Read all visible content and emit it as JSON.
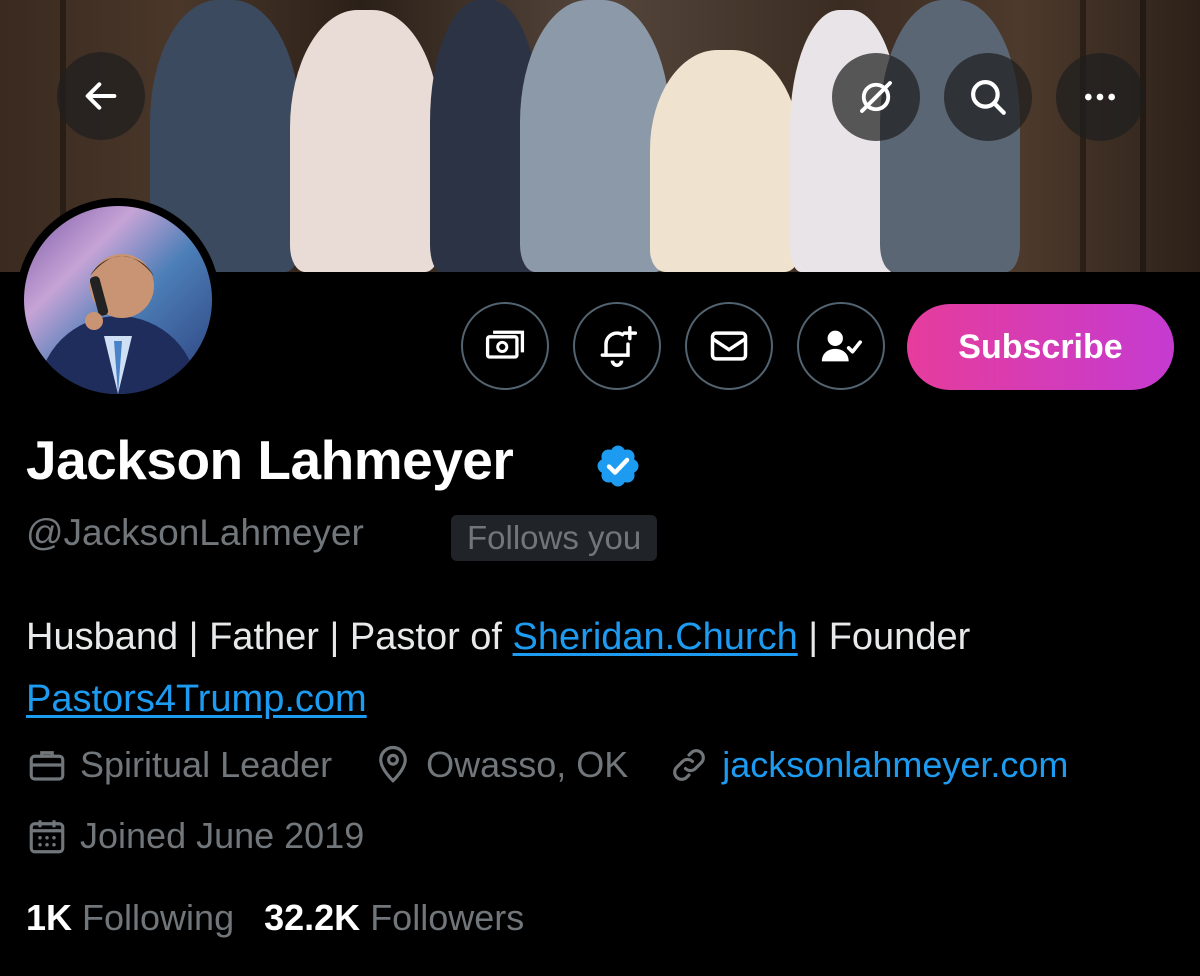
{
  "profile": {
    "display_name": "Jackson Lahmeyer",
    "handle": "@JacksonLahmeyer",
    "follows_you": "Follows you",
    "subscribe_label": "Subscribe",
    "bio": {
      "text1": "Husband | Father | Pastor of ",
      "link1": "Sheridan.Church",
      "text2": " | Founder ",
      "link2": "Pastors4Trump.com"
    },
    "category": "Spiritual Leader",
    "location": "Owasso, OK",
    "website": "jacksonlahmeyer.com",
    "joined": "Joined June 2019",
    "following_count": "1K",
    "following_label": "Following",
    "followers_count": "32.2K",
    "followers_label": "Followers"
  },
  "icons": {
    "back": "arrow-left-icon",
    "grok": "grok-icon",
    "search": "search-icon",
    "more": "more-icon",
    "tip": "money-icon",
    "notify": "bell-plus-icon",
    "message": "envelope-icon",
    "following": "person-check-icon",
    "verified": "verified-badge-icon"
  },
  "colors": {
    "accent": "#1d9bf0",
    "subscribe_start": "#e63c9c",
    "subscribe_end": "#c53bd0",
    "muted": "#71767b"
  }
}
